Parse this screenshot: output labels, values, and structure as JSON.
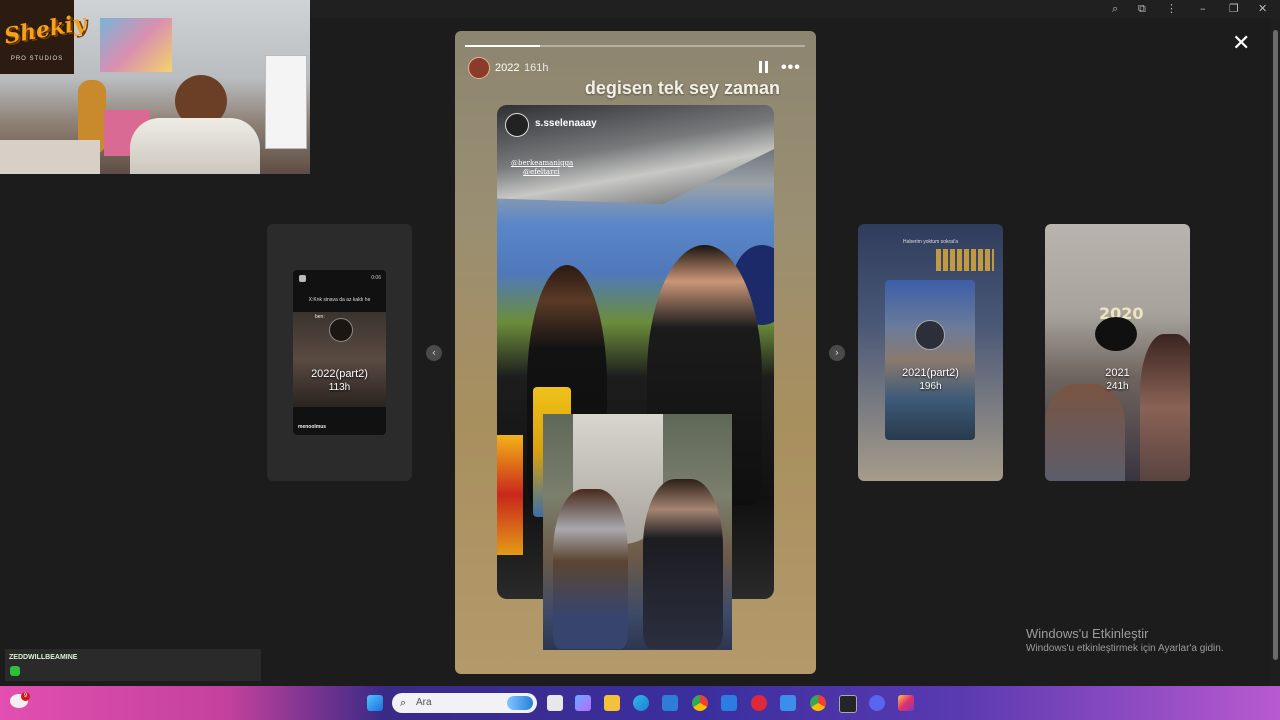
{
  "browser": {
    "zoom_icon": "zoom-icon",
    "extensions_icon": "puzzle-icon",
    "menu_icon": "kebab-icon"
  },
  "webcam": {
    "logo_text": "Shekiy",
    "logo_sub": "PRO STUDIOS"
  },
  "viewer": {
    "close_label": "✕"
  },
  "stories": {
    "prev_card": {
      "title": "2022(part2)",
      "time": "113h",
      "inner_top_time": "0:06",
      "inner_caption": "X:Knk sinava da az kaldı he",
      "inner_small": "ben:",
      "inner_user": "menoolmus"
    },
    "active": {
      "user": "2022",
      "time": "161h",
      "caption": "degisen tek sey zaman",
      "progress": 0.22,
      "embedded_user": "s.sselenaaay",
      "mention_1": "@berkeamaniggа",
      "mention_2": "@efeltarci"
    },
    "next_card_1": {
      "title": "2021(part2)",
      "time": "196h",
      "inner_top_text": "Haberim yoktum sokrat'a"
    },
    "next_card_2": {
      "title": "2021",
      "time": "241h",
      "overlay_text": "2020"
    }
  },
  "chat": {
    "username": "ZEDDWILLBEAMINE"
  },
  "watermark": {
    "title": "Windows'u Etkinleştir",
    "subtitle": "Windows'u etkinleştirmek için Ayarlar'a gidin."
  },
  "taskbar": {
    "weather_badge": "9",
    "search_placeholder": "Ara",
    "colors": {
      "start": "#1e90ff",
      "search_bg": "#f2f2f6"
    }
  }
}
